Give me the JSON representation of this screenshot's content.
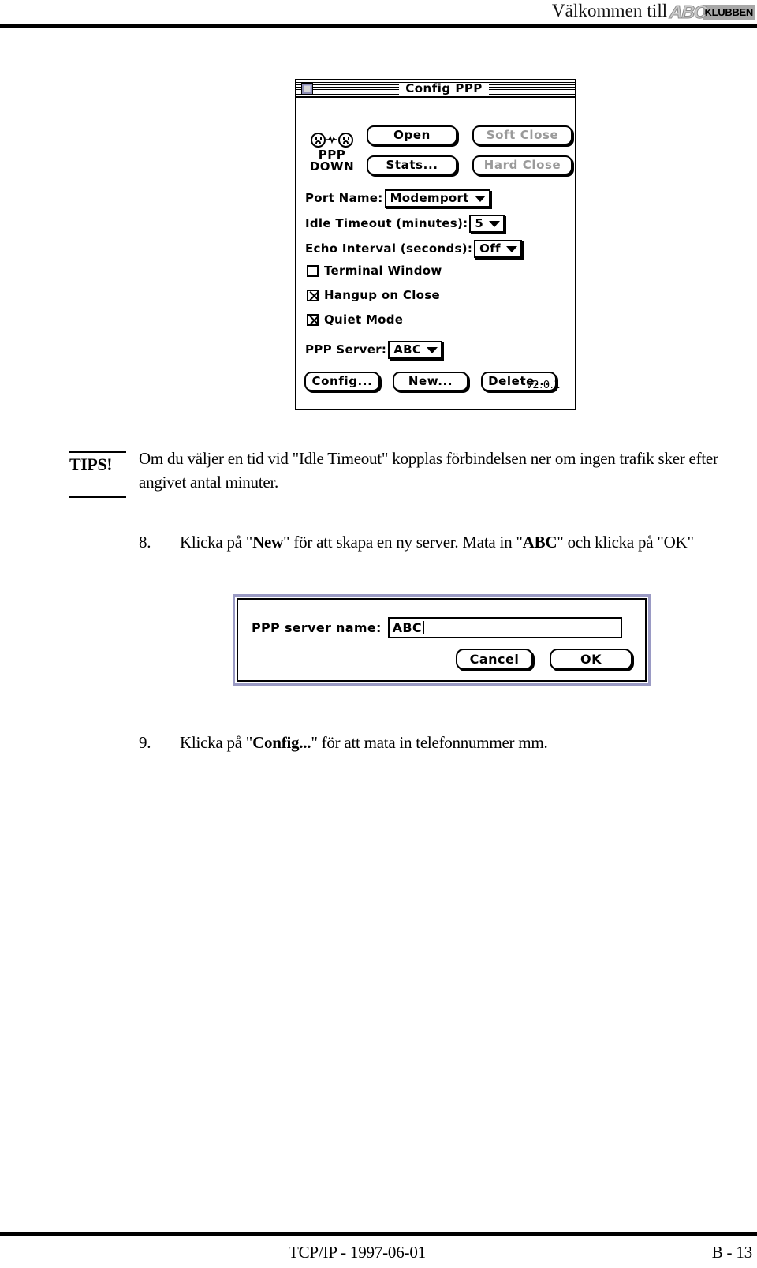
{
  "header": {
    "title": "Välkommen till",
    "logo": {
      "abc": "ABC",
      "klubben": "KLUBBEN"
    }
  },
  "config_ppp_window": {
    "title": "Config PPP",
    "status": {
      "icon": "two-sad-faces-broken-link",
      "line1": "PPP",
      "line2": "DOWN"
    },
    "buttons": {
      "open": "Open",
      "soft_close": "Soft Close",
      "stats": "Stats...",
      "hard_close": "Hard Close",
      "config": "Config...",
      "new": "New...",
      "delete": "Delete..."
    },
    "fields": {
      "port_name_label": "Port Name:",
      "port_name_value": "Modemport",
      "idle_timeout_label": "Idle Timeout (minutes):",
      "idle_timeout_value": "5",
      "echo_interval_label": "Echo Interval (seconds):",
      "echo_interval_value": "Off",
      "ppp_server_label": "PPP Server:",
      "ppp_server_value": "ABC"
    },
    "checkboxes": [
      {
        "label": "Terminal Window",
        "checked": false
      },
      {
        "label": "Hangup on Close",
        "checked": true
      },
      {
        "label": "Quiet Mode",
        "checked": true
      }
    ],
    "version": "v2.0.1"
  },
  "tips": {
    "label": "TIPS!",
    "text": "Om du väljer en tid vid \"Idle Timeout\" kopplas förbindelsen ner om ingen trafik sker efter angivet antal minuter."
  },
  "steps": [
    {
      "number": "8.",
      "parts": [
        {
          "t": "Klicka på \"",
          "b": false
        },
        {
          "t": "New",
          "b": true
        },
        {
          "t": "\" för att skapa en ny server. Mata in \"",
          "b": false
        },
        {
          "t": "ABC",
          "b": true
        },
        {
          "t": "\" och klicka på \"OK\"",
          "b": false
        }
      ]
    },
    {
      "number": "9.",
      "parts": [
        {
          "t": "Klicka på \"",
          "b": false
        },
        {
          "t": "Config...",
          "b": true
        },
        {
          "t": "\" för att mata in telefonnummer mm.",
          "b": false
        }
      ]
    }
  ],
  "server_name_dialog": {
    "label": "PPP server name:",
    "value": "ABC",
    "cancel": "Cancel",
    "ok": "OK"
  },
  "footer": {
    "left": "TCP/IP - 1997-06-01",
    "right": "B - 13"
  },
  "colors": {
    "rule": "#000000",
    "dialog_border": "#9a9ac4",
    "close_box": "#b9b9d8",
    "disabled_text": "#9a9a9a",
    "logo_gray": "#a8a8a8"
  }
}
